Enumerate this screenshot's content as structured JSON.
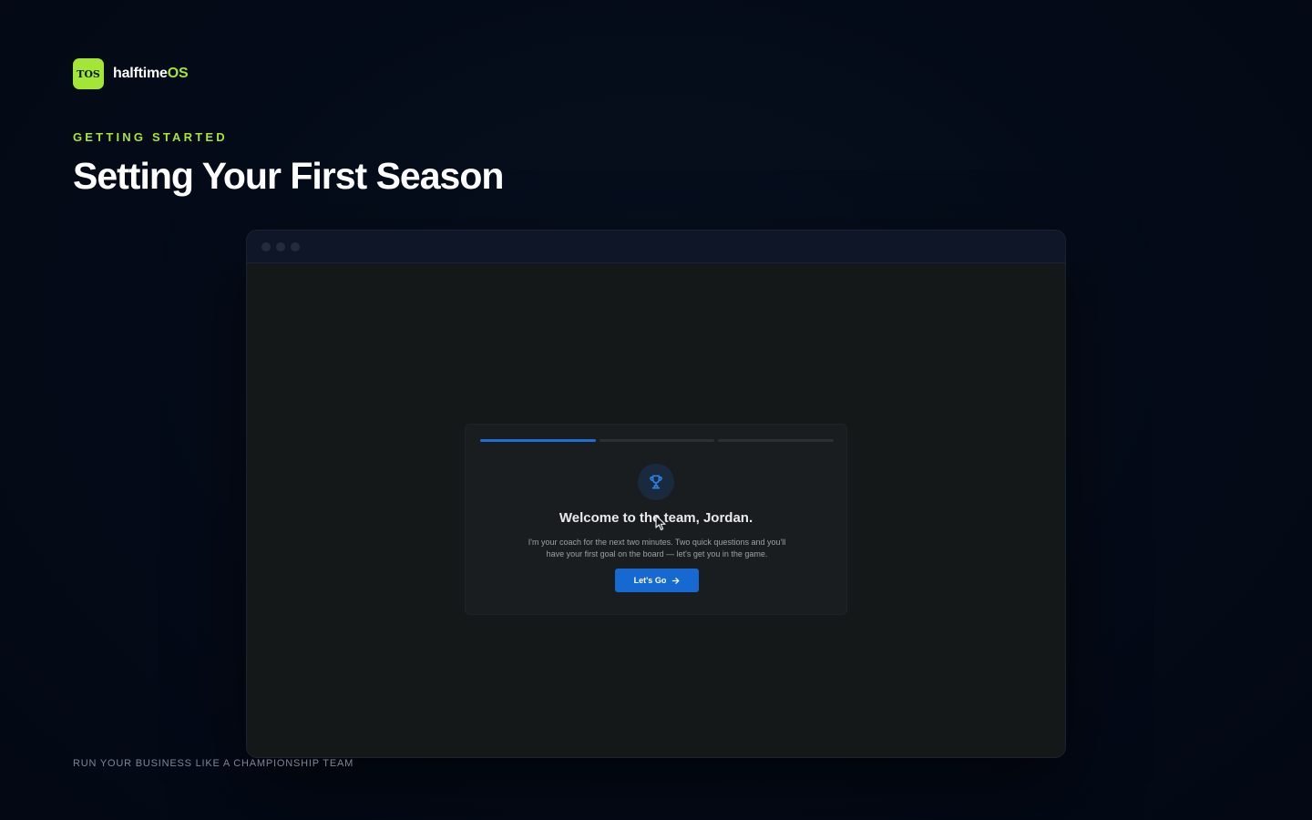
{
  "brand": {
    "logo_text": "TOS",
    "name_part1": "halftime",
    "name_part2": "OS",
    "accent_color": "#a3e635"
  },
  "header": {
    "eyebrow": "GETTING STARTED",
    "title": "Setting Your First Season"
  },
  "onboarding": {
    "progress": {
      "steps_total": 3,
      "current_step": 1
    },
    "icon": "trophy-icon",
    "title": "Welcome to the team, Jordan.",
    "body": "I'm your coach for the next two minutes. Two quick questions and you'll have your first goal on the board — let's get you in the game.",
    "cta_label": "Let's Go",
    "cta_icon": "arrow-right-icon",
    "accent_color": "#1769d2"
  },
  "footer": {
    "tagline": "RUN YOUR BUSINESS LIKE A CHAMPIONSHIP TEAM"
  }
}
